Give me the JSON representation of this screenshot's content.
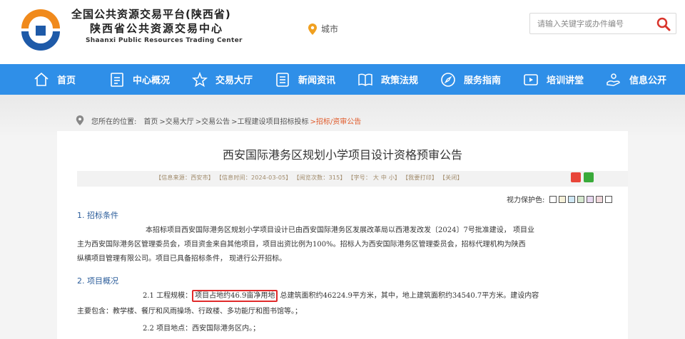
{
  "brand": {
    "line1": "全国公共资源交易平台(陕西省)",
    "line2": "陕西省公共资源交易中心",
    "line3": "Shaanxi Public Resources Trading Center"
  },
  "city": {
    "label": "城市"
  },
  "search": {
    "placeholder": "请输入关键字或办件编号"
  },
  "nav": [
    {
      "label": "首页",
      "icon": "home-icon"
    },
    {
      "label": "中心概况",
      "icon": "document-icon"
    },
    {
      "label": "交易大厅",
      "icon": "star-icon"
    },
    {
      "label": "新闻资讯",
      "icon": "news-icon"
    },
    {
      "label": "政策法规",
      "icon": "book-icon"
    },
    {
      "label": "服务指南",
      "icon": "compass-icon"
    },
    {
      "label": "培训讲堂",
      "icon": "video-icon"
    },
    {
      "label": "信息公开",
      "icon": "hand-icon"
    }
  ],
  "breadcrumb": {
    "prefix": "您所在的位置:",
    "items": [
      "首页",
      ">交易大厅",
      ">交易公告",
      ">工程建设项目招标投标",
      ">招标/资审公告"
    ]
  },
  "article": {
    "title": "西安国际港务区规划小学项目设计资格预审公告",
    "meta": "【信息来源：西安市】 【信息时间：2024-03-05】 【阅览次数：315】 【字号：  大  中  小】 【我要打印】 【关闭】",
    "protect_label": "视力保护色:",
    "swatch_colors": [
      "#ffffff",
      "#f5f0d8",
      "#cfe8f5",
      "#d6e8d0",
      "#e8d8f0",
      "#f0d8dc",
      "#ffffff"
    ],
    "sections": {
      "s1_title": "1. 招标条件",
      "s1_p1": "本招标项目西安国际港务区规划小学项目设计已由西安国际港务区发展改革局以西港发改发〔2024〕7号批准建设， 项目业",
      "s1_p2": "主为西安国际港务区管理委员会，项目资金来自其他项目，项目出资比例为100%。招标人为西安国际港务区管理委员会，招标代理机构为陕西",
      "s1_p3": "纵横项目管理有限公司。项目已具备招标条件， 现进行公开招标。",
      "s2_title": "2. 项目概况",
      "s2_1_prefix": "2.1 工程规模：",
      "s2_1_highlight": "项目占地约46.9亩净用地",
      "s2_1_rest": " 总建筑面积约46224.9平方米，其中，地上建筑面积约34540.7平方米。建设内容",
      "s2_1_p2": "主要包含：教学楼、餐厅和风雨操场、行政楼、多功能厅和图书馆等。；",
      "s2_2": "2.2 项目地点：西安国际港务区内。；"
    }
  },
  "colors": {
    "nav_bg": "#2f8fe8",
    "logo_orange": "#f08a1c",
    "logo_blue": "#1e5aa8",
    "highlight_red": "#e02a2a"
  }
}
